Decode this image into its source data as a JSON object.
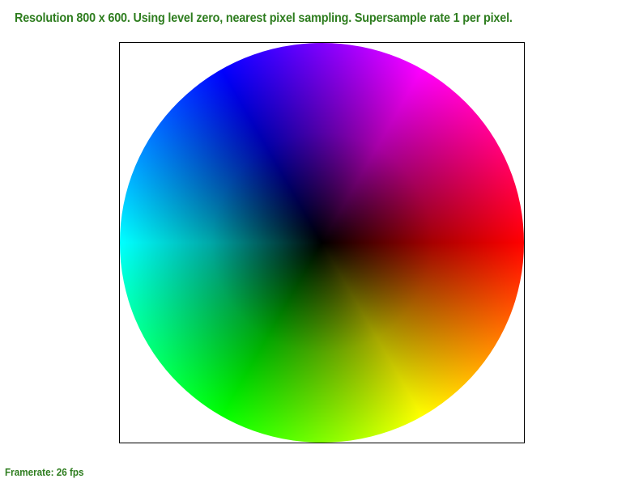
{
  "header": {
    "status_text": "Resolution 800 x 600. Using level zero, nearest pixel sampling. Supersample rate 1 per pixel."
  },
  "footer": {
    "framerate_text": "Framerate: 26 fps"
  },
  "colors": {
    "status_text": "#2e7d1f",
    "background": "#ffffff",
    "viewport_border": "#000000"
  }
}
